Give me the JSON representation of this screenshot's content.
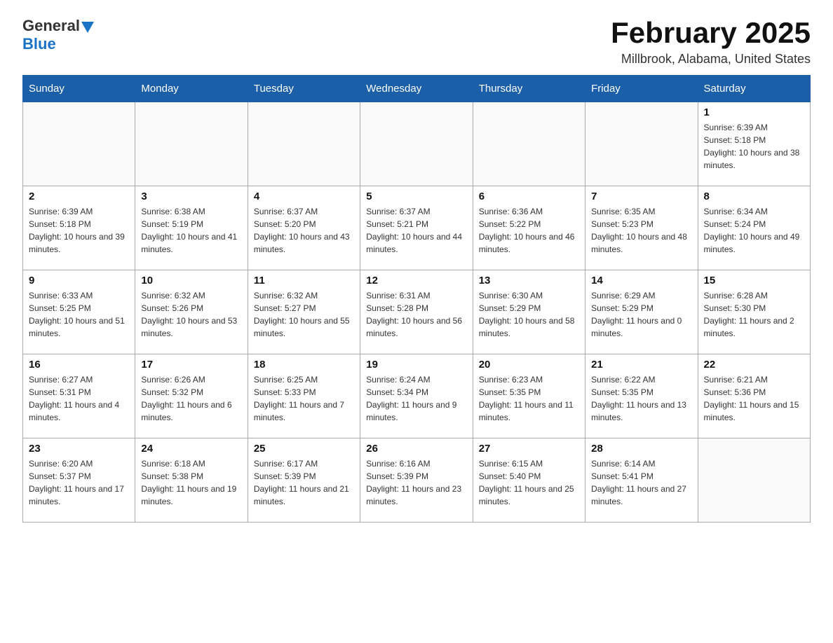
{
  "logo": {
    "general": "General",
    "blue": "Blue"
  },
  "title": "February 2025",
  "subtitle": "Millbrook, Alabama, United States",
  "days_of_week": [
    "Sunday",
    "Monday",
    "Tuesday",
    "Wednesday",
    "Thursday",
    "Friday",
    "Saturday"
  ],
  "weeks": [
    [
      {
        "day": "",
        "sunrise": "",
        "sunset": "",
        "daylight": ""
      },
      {
        "day": "",
        "sunrise": "",
        "sunset": "",
        "daylight": ""
      },
      {
        "day": "",
        "sunrise": "",
        "sunset": "",
        "daylight": ""
      },
      {
        "day": "",
        "sunrise": "",
        "sunset": "",
        "daylight": ""
      },
      {
        "day": "",
        "sunrise": "",
        "sunset": "",
        "daylight": ""
      },
      {
        "day": "",
        "sunrise": "",
        "sunset": "",
        "daylight": ""
      },
      {
        "day": "1",
        "sunrise": "Sunrise: 6:39 AM",
        "sunset": "Sunset: 5:18 PM",
        "daylight": "Daylight: 10 hours and 38 minutes."
      }
    ],
    [
      {
        "day": "2",
        "sunrise": "Sunrise: 6:39 AM",
        "sunset": "Sunset: 5:18 PM",
        "daylight": "Daylight: 10 hours and 39 minutes."
      },
      {
        "day": "3",
        "sunrise": "Sunrise: 6:38 AM",
        "sunset": "Sunset: 5:19 PM",
        "daylight": "Daylight: 10 hours and 41 minutes."
      },
      {
        "day": "4",
        "sunrise": "Sunrise: 6:37 AM",
        "sunset": "Sunset: 5:20 PM",
        "daylight": "Daylight: 10 hours and 43 minutes."
      },
      {
        "day": "5",
        "sunrise": "Sunrise: 6:37 AM",
        "sunset": "Sunset: 5:21 PM",
        "daylight": "Daylight: 10 hours and 44 minutes."
      },
      {
        "day": "6",
        "sunrise": "Sunrise: 6:36 AM",
        "sunset": "Sunset: 5:22 PM",
        "daylight": "Daylight: 10 hours and 46 minutes."
      },
      {
        "day": "7",
        "sunrise": "Sunrise: 6:35 AM",
        "sunset": "Sunset: 5:23 PM",
        "daylight": "Daylight: 10 hours and 48 minutes."
      },
      {
        "day": "8",
        "sunrise": "Sunrise: 6:34 AM",
        "sunset": "Sunset: 5:24 PM",
        "daylight": "Daylight: 10 hours and 49 minutes."
      }
    ],
    [
      {
        "day": "9",
        "sunrise": "Sunrise: 6:33 AM",
        "sunset": "Sunset: 5:25 PM",
        "daylight": "Daylight: 10 hours and 51 minutes."
      },
      {
        "day": "10",
        "sunrise": "Sunrise: 6:32 AM",
        "sunset": "Sunset: 5:26 PM",
        "daylight": "Daylight: 10 hours and 53 minutes."
      },
      {
        "day": "11",
        "sunrise": "Sunrise: 6:32 AM",
        "sunset": "Sunset: 5:27 PM",
        "daylight": "Daylight: 10 hours and 55 minutes."
      },
      {
        "day": "12",
        "sunrise": "Sunrise: 6:31 AM",
        "sunset": "Sunset: 5:28 PM",
        "daylight": "Daylight: 10 hours and 56 minutes."
      },
      {
        "day": "13",
        "sunrise": "Sunrise: 6:30 AM",
        "sunset": "Sunset: 5:29 PM",
        "daylight": "Daylight: 10 hours and 58 minutes."
      },
      {
        "day": "14",
        "sunrise": "Sunrise: 6:29 AM",
        "sunset": "Sunset: 5:29 PM",
        "daylight": "Daylight: 11 hours and 0 minutes."
      },
      {
        "day": "15",
        "sunrise": "Sunrise: 6:28 AM",
        "sunset": "Sunset: 5:30 PM",
        "daylight": "Daylight: 11 hours and 2 minutes."
      }
    ],
    [
      {
        "day": "16",
        "sunrise": "Sunrise: 6:27 AM",
        "sunset": "Sunset: 5:31 PM",
        "daylight": "Daylight: 11 hours and 4 minutes."
      },
      {
        "day": "17",
        "sunrise": "Sunrise: 6:26 AM",
        "sunset": "Sunset: 5:32 PM",
        "daylight": "Daylight: 11 hours and 6 minutes."
      },
      {
        "day": "18",
        "sunrise": "Sunrise: 6:25 AM",
        "sunset": "Sunset: 5:33 PM",
        "daylight": "Daylight: 11 hours and 7 minutes."
      },
      {
        "day": "19",
        "sunrise": "Sunrise: 6:24 AM",
        "sunset": "Sunset: 5:34 PM",
        "daylight": "Daylight: 11 hours and 9 minutes."
      },
      {
        "day": "20",
        "sunrise": "Sunrise: 6:23 AM",
        "sunset": "Sunset: 5:35 PM",
        "daylight": "Daylight: 11 hours and 11 minutes."
      },
      {
        "day": "21",
        "sunrise": "Sunrise: 6:22 AM",
        "sunset": "Sunset: 5:35 PM",
        "daylight": "Daylight: 11 hours and 13 minutes."
      },
      {
        "day": "22",
        "sunrise": "Sunrise: 6:21 AM",
        "sunset": "Sunset: 5:36 PM",
        "daylight": "Daylight: 11 hours and 15 minutes."
      }
    ],
    [
      {
        "day": "23",
        "sunrise": "Sunrise: 6:20 AM",
        "sunset": "Sunset: 5:37 PM",
        "daylight": "Daylight: 11 hours and 17 minutes."
      },
      {
        "day": "24",
        "sunrise": "Sunrise: 6:18 AM",
        "sunset": "Sunset: 5:38 PM",
        "daylight": "Daylight: 11 hours and 19 minutes."
      },
      {
        "day": "25",
        "sunrise": "Sunrise: 6:17 AM",
        "sunset": "Sunset: 5:39 PM",
        "daylight": "Daylight: 11 hours and 21 minutes."
      },
      {
        "day": "26",
        "sunrise": "Sunrise: 6:16 AM",
        "sunset": "Sunset: 5:39 PM",
        "daylight": "Daylight: 11 hours and 23 minutes."
      },
      {
        "day": "27",
        "sunrise": "Sunrise: 6:15 AM",
        "sunset": "Sunset: 5:40 PM",
        "daylight": "Daylight: 11 hours and 25 minutes."
      },
      {
        "day": "28",
        "sunrise": "Sunrise: 6:14 AM",
        "sunset": "Sunset: 5:41 PM",
        "daylight": "Daylight: 11 hours and 27 minutes."
      },
      {
        "day": "",
        "sunrise": "",
        "sunset": "",
        "daylight": ""
      }
    ]
  ]
}
